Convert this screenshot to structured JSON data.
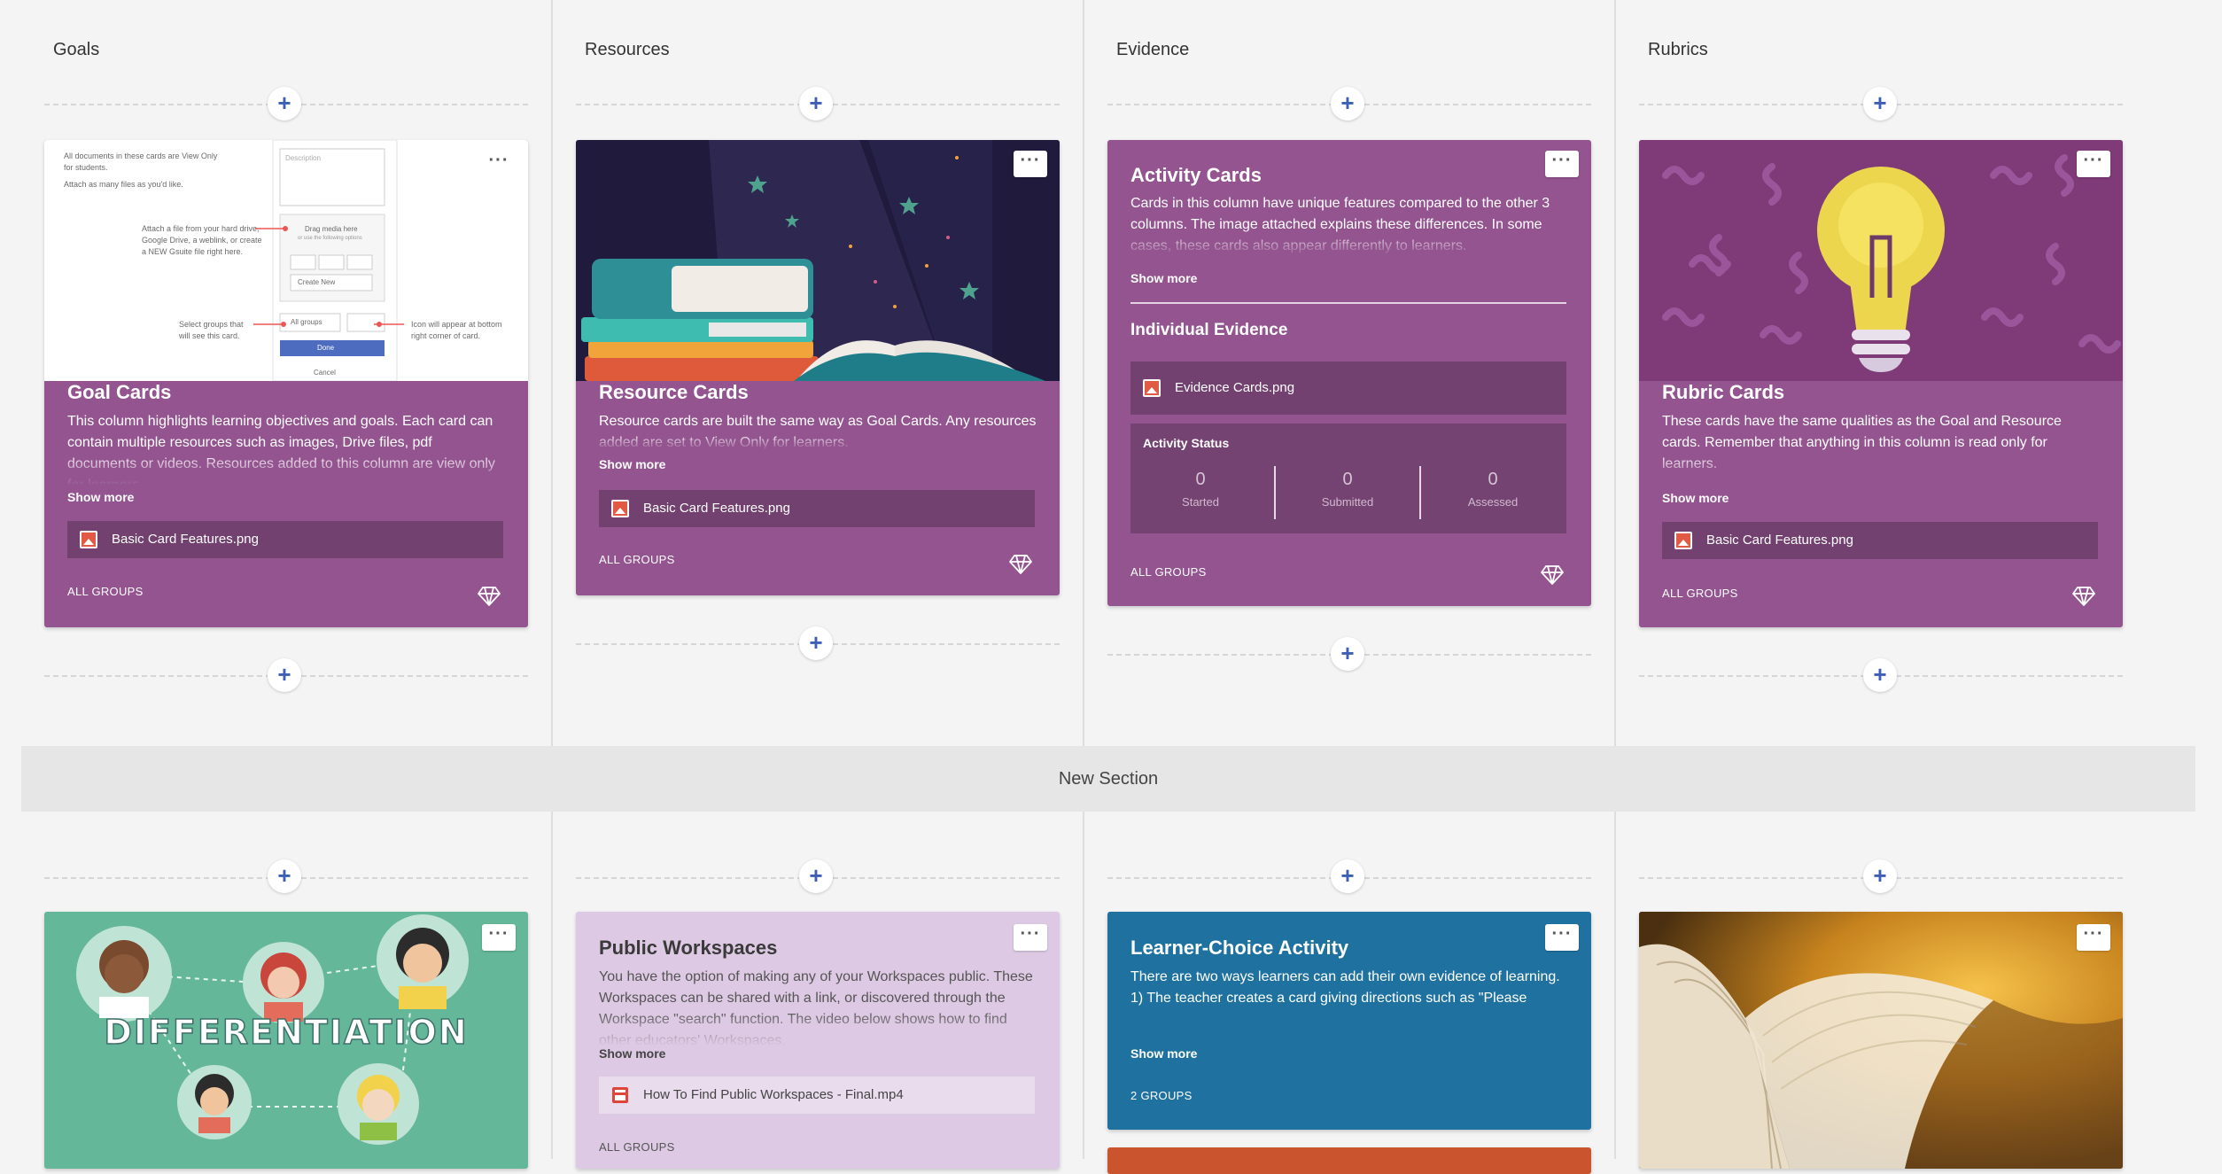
{
  "columns": [
    "Goals",
    "Resources",
    "Evidence",
    "Rubrics"
  ],
  "section": {
    "name": "New Section"
  },
  "colors": {
    "purple": "#93548f",
    "lavender": "#ddc9e3",
    "blue": "#1f72a0",
    "plus": "#3d5eb5",
    "differentiation_bg": "#65b79a"
  },
  "row1": {
    "goal": {
      "title": "Goal Cards",
      "desc": "This column highlights learning objectives and goals. Each card can contain multiple resources such as images, Drive files, pdf documents or videos. Resources added to this column are view only for learners.",
      "show_more": "Show more",
      "attachment": "Basic Card Features.png",
      "groups": "ALL GROUPS",
      "shot": {
        "l1": "All documents in these cards are View Only",
        "l2": "for students.",
        "l3": "Attach as many files as you'd like.",
        "m1": "Attach a file from your hard drive,",
        "m2": "Google Drive, a weblink, or create",
        "m3": "a NEW Gsuite file right here.",
        "s1": "Select groups that",
        "s2": "will see this card.",
        "r1": "Icon will appear at bottom",
        "r2": "right corner of card.",
        "desc_ph": "Description",
        "drag": "Drag media here",
        "drag2": "or use the following options",
        "create": "Create New",
        "allg": "All groups",
        "done": "Done",
        "cancel": "Cancel"
      }
    },
    "resource": {
      "title": "Resource Cards",
      "desc": "Resource cards are built the same way as Goal Cards. Any resources added are set to View Only for learners.",
      "show_more": "Show more",
      "attachment": "Basic Card Features.png",
      "groups": "ALL GROUPS"
    },
    "evidence": {
      "title": "Activity Cards",
      "desc": "Cards in this column have unique features compared to the other 3 columns. The image attached explains these differences. In some cases, these cards also appear differently to learners.",
      "show_more": "Show more",
      "individual_heading": "Individual Evidence",
      "attachment": "Evidence Cards.png",
      "status_label": "Activity Status",
      "stats": [
        {
          "value": "0",
          "label": "Started"
        },
        {
          "value": "0",
          "label": "Submitted"
        },
        {
          "value": "0",
          "label": "Assessed"
        }
      ],
      "groups": "ALL GROUPS"
    },
    "rubric": {
      "title": "Rubric Cards",
      "desc": "These cards have the same qualities as the Goal and Resource cards. Remember that anything in this column is read only for learners.",
      "show_more": "Show more",
      "attachment": "Basic Card Features.png",
      "groups": "ALL GROUPS"
    }
  },
  "row2": {
    "differentiation": {
      "image_text": "DIFFERENTIATION"
    },
    "workspaces": {
      "title": "Public Workspaces",
      "desc": "You have the option of making any of your Workspaces public. These Workspaces can be shared with a link, or discovered through the Workspace \"search\" function. The video below shows how to find other educators' Workspaces.",
      "show_more": "Show more",
      "attachment": "How To Find Public Workspaces - Final.mp4",
      "groups": "ALL GROUPS"
    },
    "learner": {
      "title": "Learner-Choice Activity",
      "desc": "There are two ways learners can add their own evidence of learning. 1) The teacher creates a card giving directions such as \"Please",
      "show_more": "Show more",
      "groups": "2 GROUPS"
    }
  },
  "menu_label": "···",
  "plus_label": "+"
}
